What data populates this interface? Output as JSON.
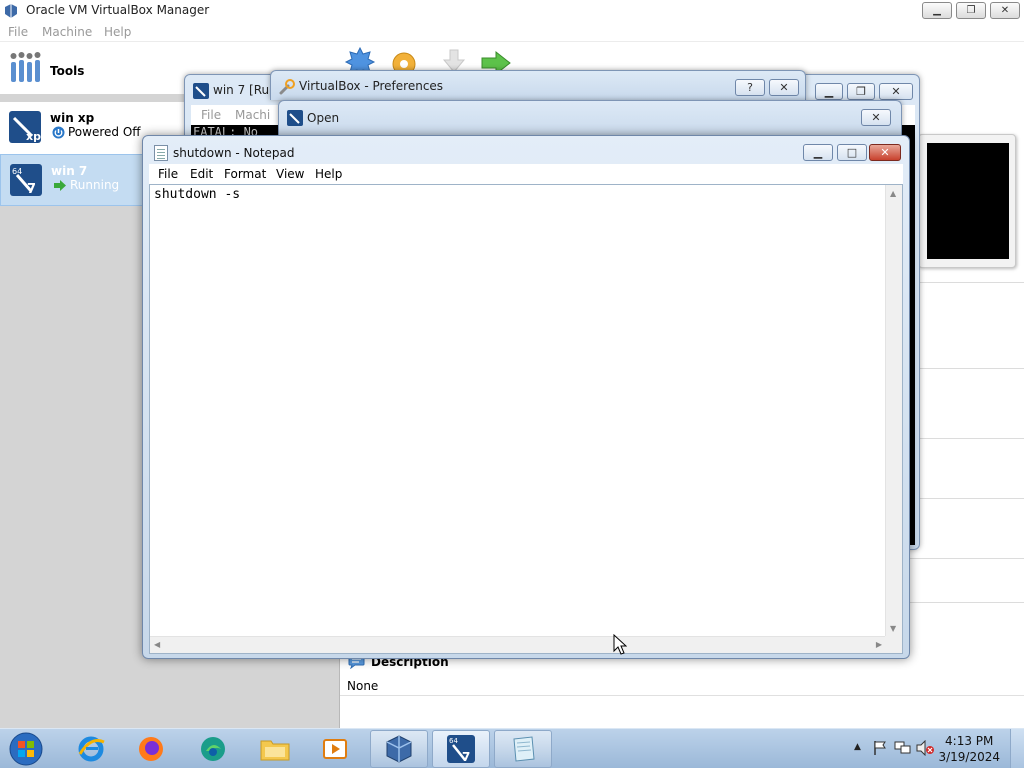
{
  "manager": {
    "title": "Oracle VM VirtualBox Manager",
    "menu": [
      "File",
      "Machine",
      "Help"
    ],
    "tools_label": "Tools",
    "vms": [
      {
        "name": "win xp",
        "state": "Powered Off",
        "badge": "xp"
      },
      {
        "name": "win 7",
        "state": "Running",
        "badge": "7"
      }
    ],
    "description_header": "Description",
    "description_value": "None"
  },
  "vm_window": {
    "title": "win 7 [Run",
    "menu": [
      "File",
      "Machi"
    ],
    "console_text": "FATAL: No"
  },
  "preferences_dialog": {
    "title": "VirtualBox - Preferences"
  },
  "open_dialog": {
    "title": "Open"
  },
  "notepad": {
    "title": "shutdown - Notepad",
    "menu": [
      "File",
      "Edit",
      "Format",
      "View",
      "Help"
    ],
    "content": "shutdown -s"
  },
  "taskbar": {
    "time": "4:13 PM",
    "date": "3/19/2024",
    "apps": [
      "internet-explorer",
      "firefox",
      "edge",
      "file-explorer",
      "media-player",
      "virtualbox",
      "win7-vm",
      "notepad"
    ]
  },
  "colors": {
    "selection": "#c4dcf2",
    "running_arrow": "#3aa93a",
    "close_red": "#c8412d"
  }
}
